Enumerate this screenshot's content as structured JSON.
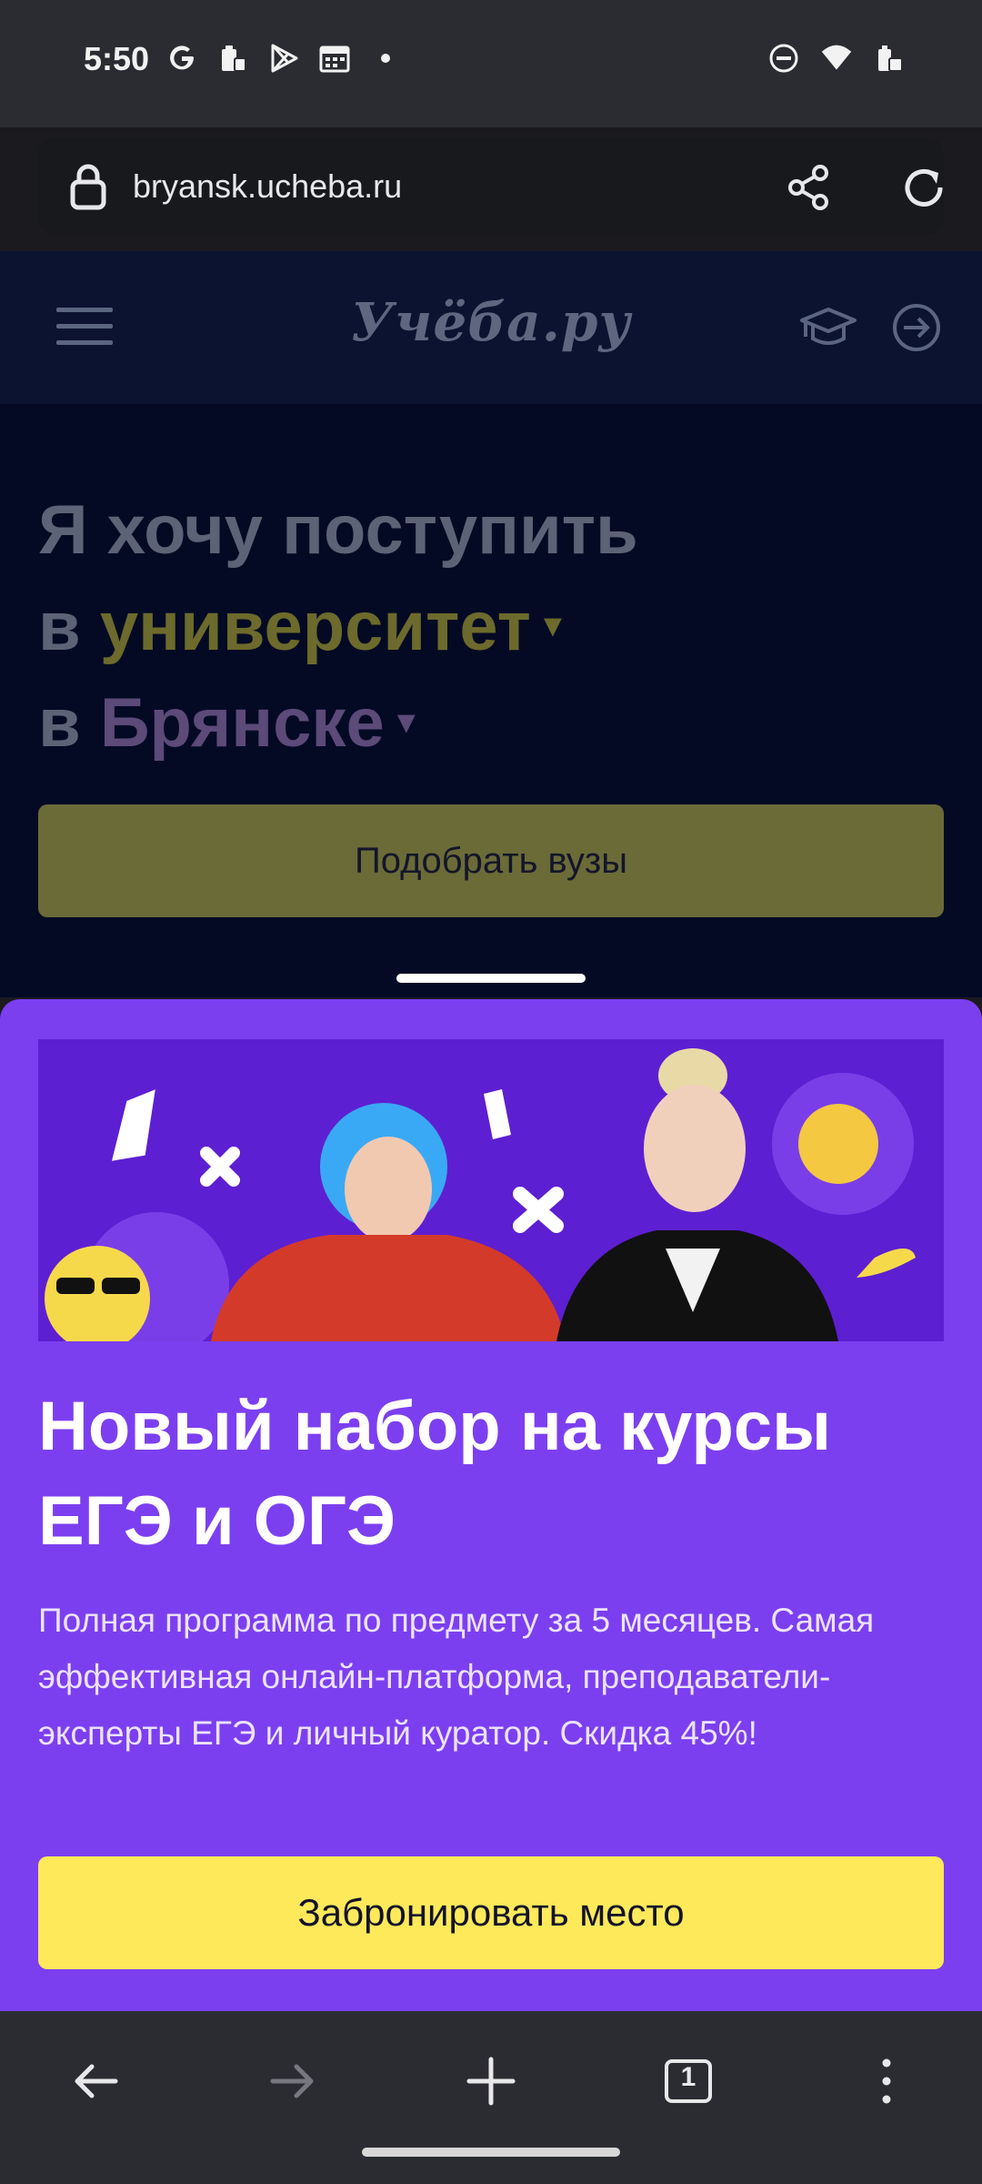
{
  "status_bar": {
    "time": "5:50",
    "left_icons": [
      "google-icon",
      "lock-clipboard-icon",
      "play-store-icon",
      "calendar-icon",
      "dot-icon"
    ],
    "right_icons": [
      "do-not-disturb-icon",
      "wifi-icon",
      "battery-icon"
    ]
  },
  "browser": {
    "url": "bryansk.ucheba.ru"
  },
  "site": {
    "logo": "Учёба.ру",
    "hero_line1": "Я хочу поступить",
    "hero_line2_prefix": "в ",
    "hero_line2_accent": "университет",
    "hero_line3_prefix": "в ",
    "hero_line3_accent": "Брянске",
    "dropdown_glyph": "▾",
    "pick_button": "Подобрать вузы"
  },
  "sheet": {
    "title": "Новый набор на курсы ЕГЭ и ОГЭ",
    "description": "Полная программа по предмету за 5 месяцев. Самая эффективная онлайн-платформа, преподаватели-эксперты ЕГЭ и личный куратор. Скидка 45%!",
    "button": "Забронировать место"
  },
  "nav": {
    "tab_count": "1"
  },
  "colors": {
    "sheet_bg": "#7c3ff0",
    "button_yellow": "#fde95a",
    "page_bg": "#050a24"
  }
}
